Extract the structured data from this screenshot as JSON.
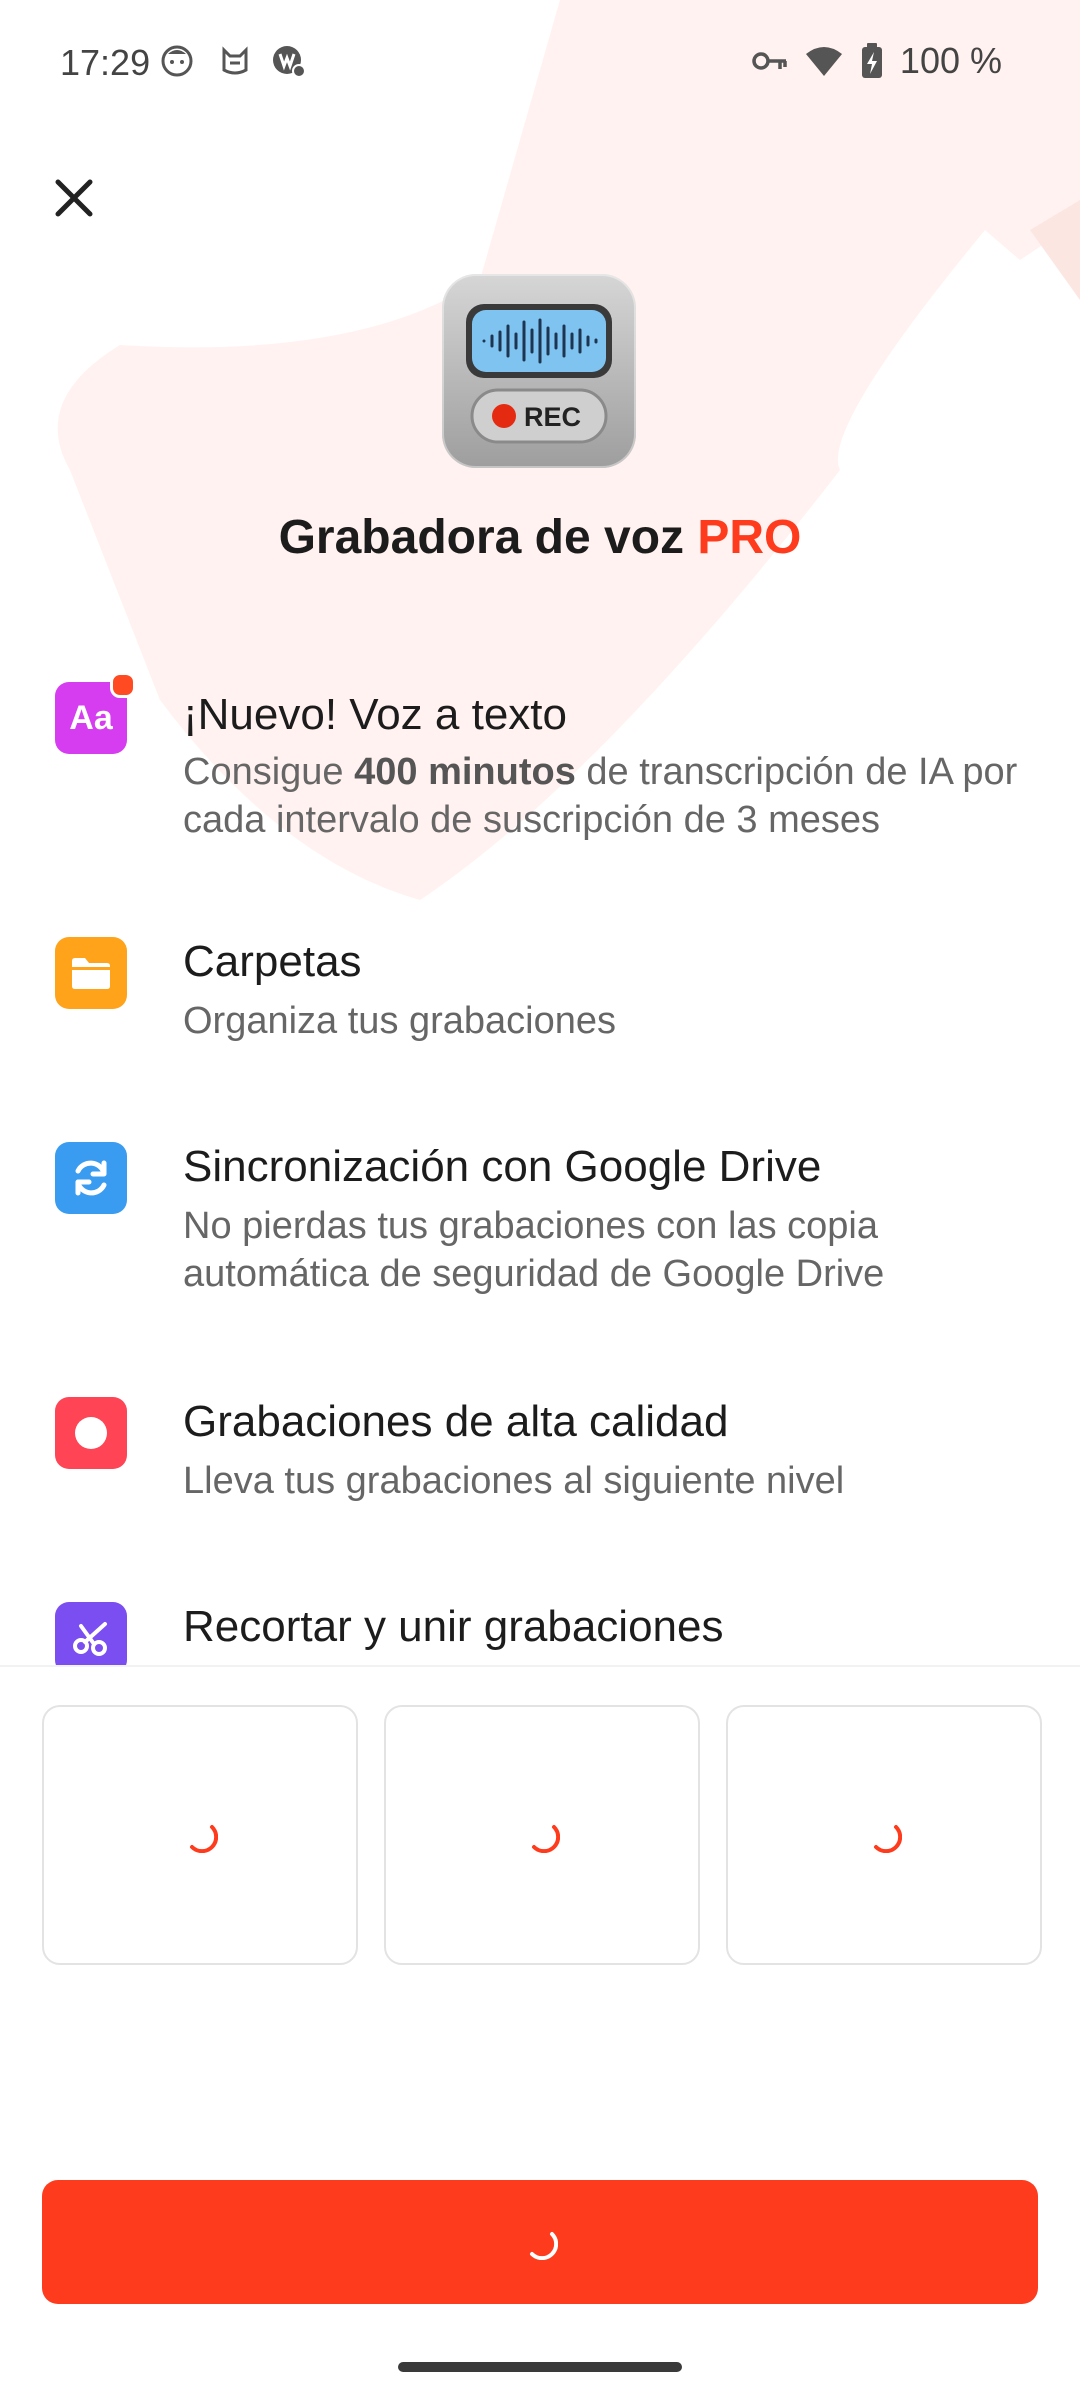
{
  "status_bar": {
    "time": "17:29",
    "battery_text": "100 %",
    "left_icons": [
      "face-notification-icon",
      "cat-notification-icon",
      "app-badge-icon"
    ],
    "right_icons": [
      "vpn-key-icon",
      "wifi-icon",
      "battery-charging-icon"
    ]
  },
  "header": {
    "close_icon": "close-icon",
    "app_icon": {
      "name": "voice-recorder-app-icon",
      "rec_label": "REC"
    }
  },
  "title": {
    "main": "Grabadora de voz ",
    "accent": "PRO"
  },
  "features": [
    {
      "icon": "text-aa-icon",
      "icon_color": "#d63cf0",
      "has_badge": true,
      "title": "¡Nuevo! Voz a texto",
      "desc_before": "Consigue ",
      "desc_bold": "400 minutos",
      "desc_after": " de transcripción de IA por cada intervalo de suscripción de 3 meses"
    },
    {
      "icon": "folder-icon",
      "icon_color": "#ffa31a",
      "title": "Carpetas",
      "desc": "Organiza tus grabaciones"
    },
    {
      "icon": "sync-icon",
      "icon_color": "#3a9cf0",
      "title": "Sincronización con Google Drive",
      "desc": "No pierdas tus grabaciones con las copia automática de seguridad de Google Drive"
    },
    {
      "icon": "record-icon",
      "icon_color": "#ff4455",
      "title": "Grabaciones de alta calidad",
      "desc": "Lleva tus grabaciones al siguiente nivel"
    },
    {
      "icon": "scissors-icon",
      "icon_color": "#7a4ef0",
      "title": "Recortar y unir grabaciones"
    }
  ],
  "plans": [
    {
      "state": "loading"
    },
    {
      "state": "loading"
    },
    {
      "state": "loading"
    }
  ],
  "cta": {
    "state": "loading"
  },
  "colors": {
    "accent": "#ff3b1d",
    "spinner": "#ff3b1d"
  }
}
